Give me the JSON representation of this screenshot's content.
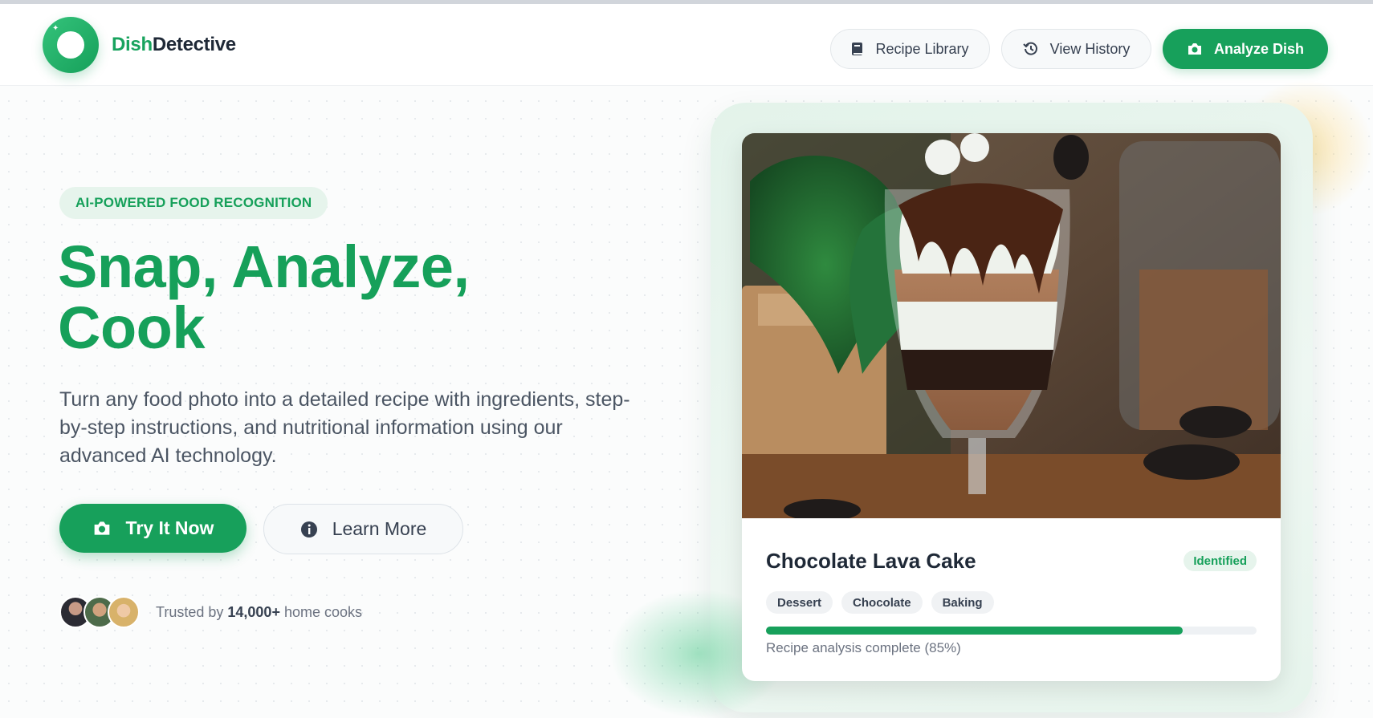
{
  "brand": {
    "name_part1": "Dish",
    "name_part2": "Detective",
    "logo_icon": "lens-ring-icon"
  },
  "nav": {
    "library_label": "Recipe Library",
    "library_icon": "book-icon",
    "history_label": "View History",
    "history_icon": "history-icon",
    "analyze_label": "Analyze Dish",
    "analyze_icon": "camera-icon"
  },
  "hero": {
    "badge": "AI-POWERED FOOD RECOGNITION",
    "headline_line1": "Snap, Analyze,",
    "headline_line2": "Cook",
    "subtext": "Turn any food photo into a detailed recipe with ingredients, step-by-step instructions, and nutritional information using our advanced AI technology.",
    "primary_cta": "Try It Now",
    "primary_cta_icon": "camera-icon",
    "secondary_cta": "Learn More",
    "secondary_cta_icon": "info-icon",
    "trust_prefix": "Trusted by",
    "trust_count": "14,000+",
    "trust_suffix": "home cooks"
  },
  "result_card": {
    "dish_name": "Chocolate Lava Cake",
    "status": "Identified",
    "tags": [
      "Dessert",
      "Chocolate",
      "Baking"
    ],
    "progress": 0.85,
    "progress_label": "Recipe analysis complete (85%)"
  },
  "colors": {
    "brand_green": "#17a05b",
    "brand_green_light": "#e6f4ec",
    "text_dark": "#1f2937",
    "text_muted": "#6b7280"
  }
}
